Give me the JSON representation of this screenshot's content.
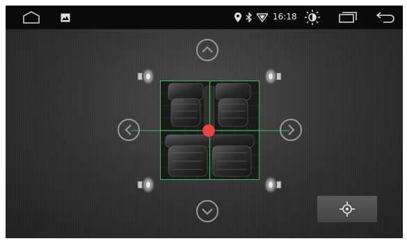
{
  "status_bar": {
    "time": "16:18",
    "icons": [
      "home-icon",
      "gallery-icon",
      "location-icon",
      "bluetooth-icon",
      "wifi-icon",
      "brightness-icon",
      "recent-apps-icon",
      "back-icon"
    ]
  },
  "balance_fader": {
    "controls": [
      "arrow-up-icon",
      "arrow-left-icon",
      "arrow-right-icon",
      "arrow-down-icon"
    ],
    "speakers": [
      "front-left",
      "front-right",
      "rear-left",
      "rear-right"
    ],
    "center_button_icon": "crosshair-icon"
  },
  "colors": {
    "status_bar": "#0a0a0a",
    "grid_line": "#3fbf4f",
    "focus_dot": "#e84545",
    "control": "#9a9a9a"
  }
}
